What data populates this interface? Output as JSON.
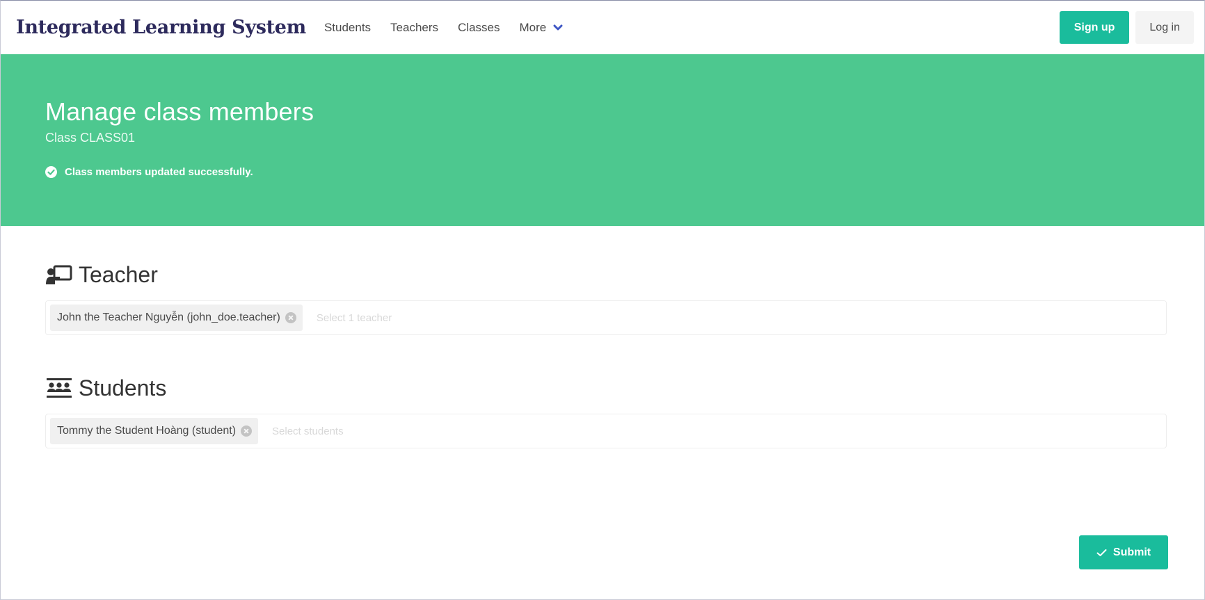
{
  "navbar": {
    "brand": "Integrated Learning System",
    "links": [
      "Students",
      "Teachers",
      "Classes"
    ],
    "more_label": "More",
    "signup_label": "Sign up",
    "login_label": "Log in"
  },
  "hero": {
    "title": "Manage class members",
    "subtitle": "Class CLASS01",
    "message": "Class members updated successfully."
  },
  "teacher_section": {
    "heading": "Teacher",
    "icon": "chalkboard-teacher-icon",
    "selected": [
      "John the Teacher Nguyễn (john_doe.teacher)"
    ],
    "placeholder": "Select 1 teacher"
  },
  "students_section": {
    "heading": "Students",
    "icon": "users-class-icon",
    "selected": [
      "Tommy the Student Hoàng (student)"
    ],
    "placeholder": "Select students"
  },
  "submit": {
    "label": "Submit",
    "icon": "check-icon"
  },
  "colors": {
    "brand": "#2d2a5c",
    "accent": "#1abc9c",
    "hero_bg": "#4dc88f",
    "chevron": "#3e56c4"
  }
}
